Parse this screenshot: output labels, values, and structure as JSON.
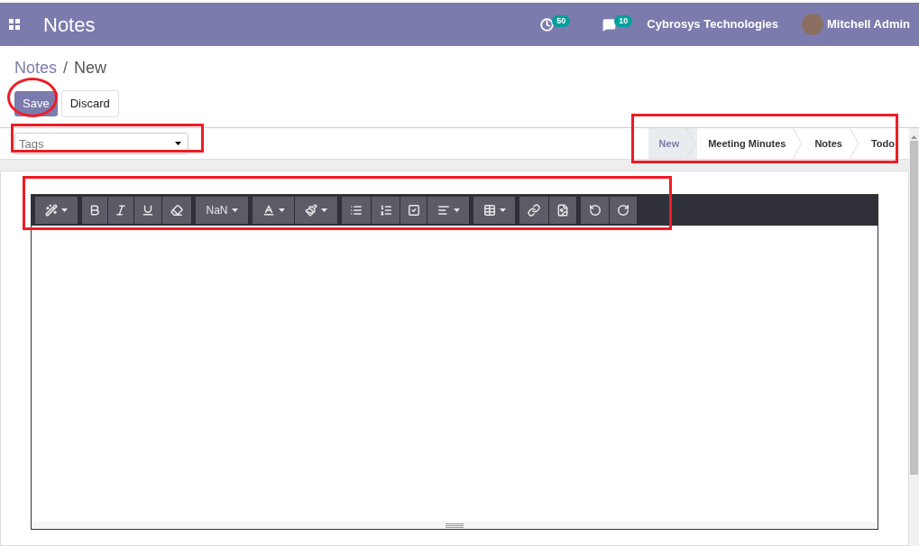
{
  "navbar": {
    "app_title": "Notes",
    "activity_count": "50",
    "message_count": "10",
    "company": "Cybrosys Technologies",
    "user": "Mitchell Admin"
  },
  "breadcrumb_separator": "/",
  "breadcrumb": [
    {
      "label": "Notes",
      "link": true
    },
    {
      "label": "New",
      "link": false
    }
  ],
  "buttons": [
    {
      "label": "Save",
      "kind": "primary"
    },
    {
      "label": "Discard",
      "kind": "secondary"
    }
  ],
  "tags": {
    "placeholder": "Tags"
  },
  "stages": [
    {
      "label": "New",
      "selected": true
    },
    {
      "label": "Meeting Minutes",
      "selected": false
    },
    {
      "label": "Notes",
      "selected": false
    },
    {
      "label": "Todo",
      "selected": false
    }
  ],
  "editor": {
    "font_size": "NaN"
  },
  "annotations": [
    {
      "kind": "ellipse"
    },
    {
      "kind": "rectangle"
    },
    {
      "kind": "rectangle"
    },
    {
      "kind": "rectangle"
    }
  ]
}
